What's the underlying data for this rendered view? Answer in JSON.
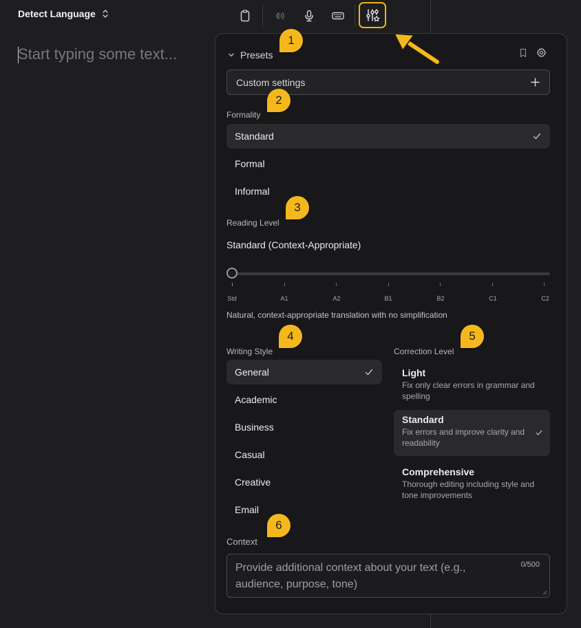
{
  "header": {
    "language_selector": "Detect Language",
    "source_placeholder": "Start typing some text...",
    "toolbar": {
      "clipboard_icon": "clipboard-icon",
      "speaker_icon": "speaker-icon",
      "microphone_icon": "microphone-icon",
      "keyboard_icon": "keyboard-icon",
      "settings_icon": "sliders-star-icon"
    }
  },
  "panel": {
    "presets": {
      "label": "Presets",
      "selected": "Custom settings"
    },
    "formality": {
      "label": "Formality",
      "options": [
        "Standard",
        "Formal",
        "Informal"
      ],
      "selected": "Standard"
    },
    "reading_level": {
      "label": "Reading Level",
      "value": "Standard (Context-Appropriate)",
      "ticks": [
        "Std",
        "A1",
        "A2",
        "B1",
        "B2",
        "C1",
        "C2"
      ],
      "position_index": 0,
      "description": "Natural, context-appropriate translation with no simplification"
    },
    "writing_style": {
      "label": "Writing Style",
      "options": [
        "General",
        "Academic",
        "Business",
        "Casual",
        "Creative",
        "Email"
      ],
      "selected": "General"
    },
    "correction_level": {
      "label": "Correction Level",
      "options": [
        {
          "title": "Light",
          "description": "Fix only clear errors in grammar and spelling"
        },
        {
          "title": "Standard",
          "description": "Fix errors and improve clarity and readability"
        },
        {
          "title": "Comprehensive",
          "description": "Thorough editing including style and tone improvements"
        }
      ],
      "selected": "Standard"
    },
    "context": {
      "label": "Context",
      "placeholder": "Provide additional context about your text (e.g., audience, purpose, tone)",
      "value": "",
      "char_count": "0/500"
    }
  },
  "annotations": {
    "markers": [
      "1",
      "2",
      "3",
      "4",
      "5",
      "6"
    ],
    "accent_color": "#f5b81c"
  }
}
